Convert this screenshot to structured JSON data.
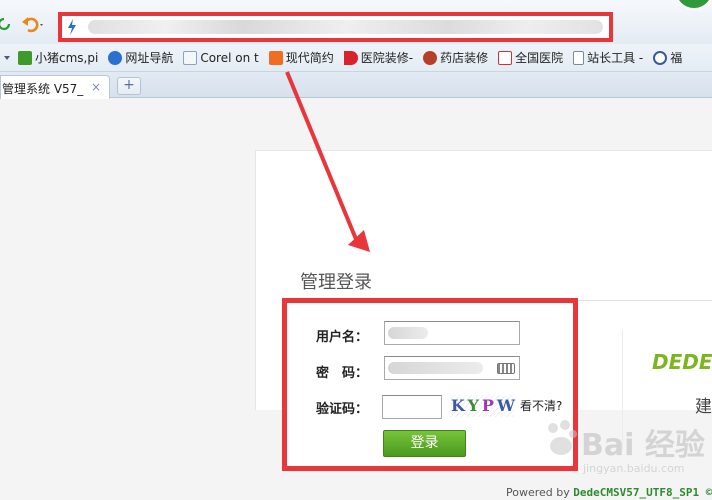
{
  "browser": {
    "bookmarks": [
      {
        "label": "小猪cms,pi",
        "icon": "pig-icon",
        "color": "#3f9a2b"
      },
      {
        "label": "网址导航",
        "icon": "compass-icon",
        "color": "#2a6fd1"
      },
      {
        "label": "Corel on t",
        "icon": "folder-icon",
        "color": "#8aa2bd"
      },
      {
        "label": "现代简约",
        "icon": "taobao-icon",
        "color": "#f36d21"
      },
      {
        "label": "医院装修-",
        "icon": "arrow-red-icon",
        "color": "#d8232a"
      },
      {
        "label": "药店装修",
        "icon": "shop-icon",
        "color": "#b4402a"
      },
      {
        "label": "全国医院",
        "icon": "hospital-icon",
        "color": "#c33"
      },
      {
        "label": "站长工具 -",
        "icon": "page-icon",
        "color": "#7f8a97"
      },
      {
        "label": "福",
        "icon": "gear-icon",
        "color": "#3a5a9c"
      }
    ],
    "tab": {
      "label": "管理系统 V57_",
      "close": "×"
    },
    "new_tab": "+"
  },
  "login": {
    "title": "管理登录",
    "username_label": "用户名：",
    "password_label": "密　码：",
    "captcha_label": "验证码：",
    "captcha_text": [
      "K",
      "Y",
      "P",
      "W"
    ],
    "refresh_text": "看不清?",
    "submit": "登录"
  },
  "brand": {
    "name": "DEDE",
    "sub": "建"
  },
  "footer": {
    "powered_prefix": "Powered by ",
    "version": "DedeCMSV57_UTF8_SP1 ©"
  },
  "watermark": {
    "text": "Bai 经验",
    "url": "jingyan.baidu.com"
  },
  "colors": {
    "highlight": "#e8363b",
    "button": "#5aa82a",
    "brand": "#7cb51f"
  }
}
